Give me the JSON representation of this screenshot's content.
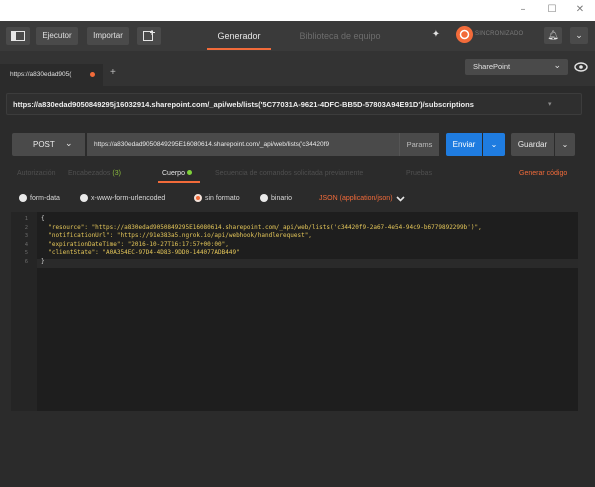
{
  "window": {
    "minimize_icon": "minimize-icon",
    "maximize_icon": "maximize-icon",
    "close_icon": "close-icon"
  },
  "toolbar": {
    "runner_label": "Ejecutor",
    "import_label": "Importar",
    "tabs": [
      "Generador",
      "Biblioteca de equipo"
    ],
    "sync_label": "SINCRONIZADO"
  },
  "request_tab": {
    "label": "https://a830edad905(",
    "add_label": "+"
  },
  "environment": {
    "selected": "SharePoint"
  },
  "request": {
    "title": "https://a830edad9050849295j16032914.sharepoint.com/_api/web/lists('5C77031A-9621-4DFC-BB5D-57803A94E91D')/subscriptions",
    "method": "POST",
    "url": "https://a830edad9050849295E16080614.sharepoint.com/_api/web/lists('c34420f9",
    "params_label": "Params",
    "send_label": "Enviar",
    "save_label": "Guardar"
  },
  "subtabs": {
    "authorization": "Autorización",
    "headers": "Encabezados",
    "headers_count": "(3)",
    "body": "Cuerpo",
    "pre_request": "Secuencia de comandos solicitada previamente",
    "tests": "Pruebas",
    "generate_code": "Generar código"
  },
  "body_types": {
    "form_data": "form-data",
    "urlencoded": "x-www-form-urlencoded",
    "raw": "sin formato",
    "binary": "binario",
    "content_type": "JSON (application/json)"
  },
  "editor": {
    "line_numbers": [
      "1",
      "2",
      "3",
      "4",
      "5",
      "6"
    ],
    "lines": [
      "{",
      "  \"resource\": \"https://a830edad9050849295E16080614.sharepoint.com/_api/web/lists('c34420f9-2a67-4e54-94c9-b6779892299b')\",",
      "  \"notificationUrl\": \"https://91e383a5.ngrok.io/api/webhook/handlerequest\",",
      "  \"expirationDateTime\": \"2016-10-27T16:17:57+00:00\",",
      "  \"clientState\": \"A0A354EC-97D4-4D83-9DD0-144077ADB449\"",
      "}"
    ]
  },
  "colors": {
    "accent": "#f26b3a",
    "primary": "#1f7ce0",
    "json_value": "#e6c85a",
    "body_dot": "#7fd23a"
  }
}
